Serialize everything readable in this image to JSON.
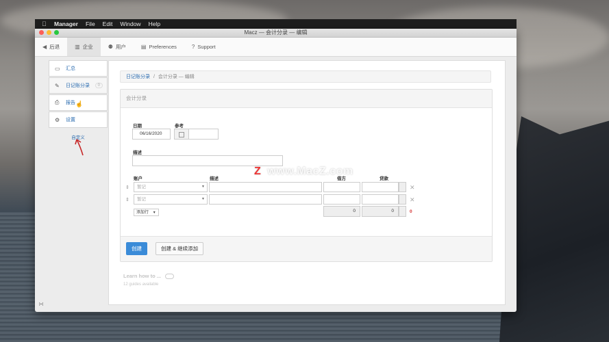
{
  "menubar": {
    "apple": "",
    "items": [
      "Manager",
      "File",
      "Edit",
      "Window",
      "Help"
    ]
  },
  "window": {
    "title": "Macz — 会计分录 — 编辑"
  },
  "toolbar": {
    "back": "后退",
    "company": "企业",
    "users": "用户",
    "preferences": "Preferences",
    "support": "Support"
  },
  "sidebar": {
    "items": [
      {
        "label": "汇总",
        "icon": "monitor-icon"
      },
      {
        "label": "日记账分录",
        "icon": "pen-icon",
        "badge": "0"
      },
      {
        "label": "报告",
        "icon": "printer-icon"
      },
      {
        "label": "设置",
        "icon": "gear-icon"
      }
    ],
    "customize": "自定义"
  },
  "breadcrumb": {
    "link": "日记账分录",
    "sep": "/",
    "current": "会计分录 — 编辑"
  },
  "form": {
    "panel_title": "会计分录",
    "date_label": "日期",
    "date_value": "06/16/2020",
    "ref_label": "参考",
    "desc_label": "描述",
    "col_account": "账户",
    "col_desc": "描述",
    "col_debit": "借方",
    "col_credit": "贷款",
    "account_placeholder": "暂记",
    "add_row": "添加行",
    "debit_total": "0",
    "credit_total": "0",
    "difference": "0",
    "create_btn": "创建",
    "create_continue_btn": "创建 & 继续添加"
  },
  "learn": {
    "title": "Learn how to ...",
    "subtitle": "12 guides available"
  },
  "watermark": {
    "z": "Z",
    "text": "www.MacZ.com"
  },
  "colors": {
    "accent": "#3a8bd8",
    "link": "#2b6cb0",
    "error": "#d32f2f"
  }
}
